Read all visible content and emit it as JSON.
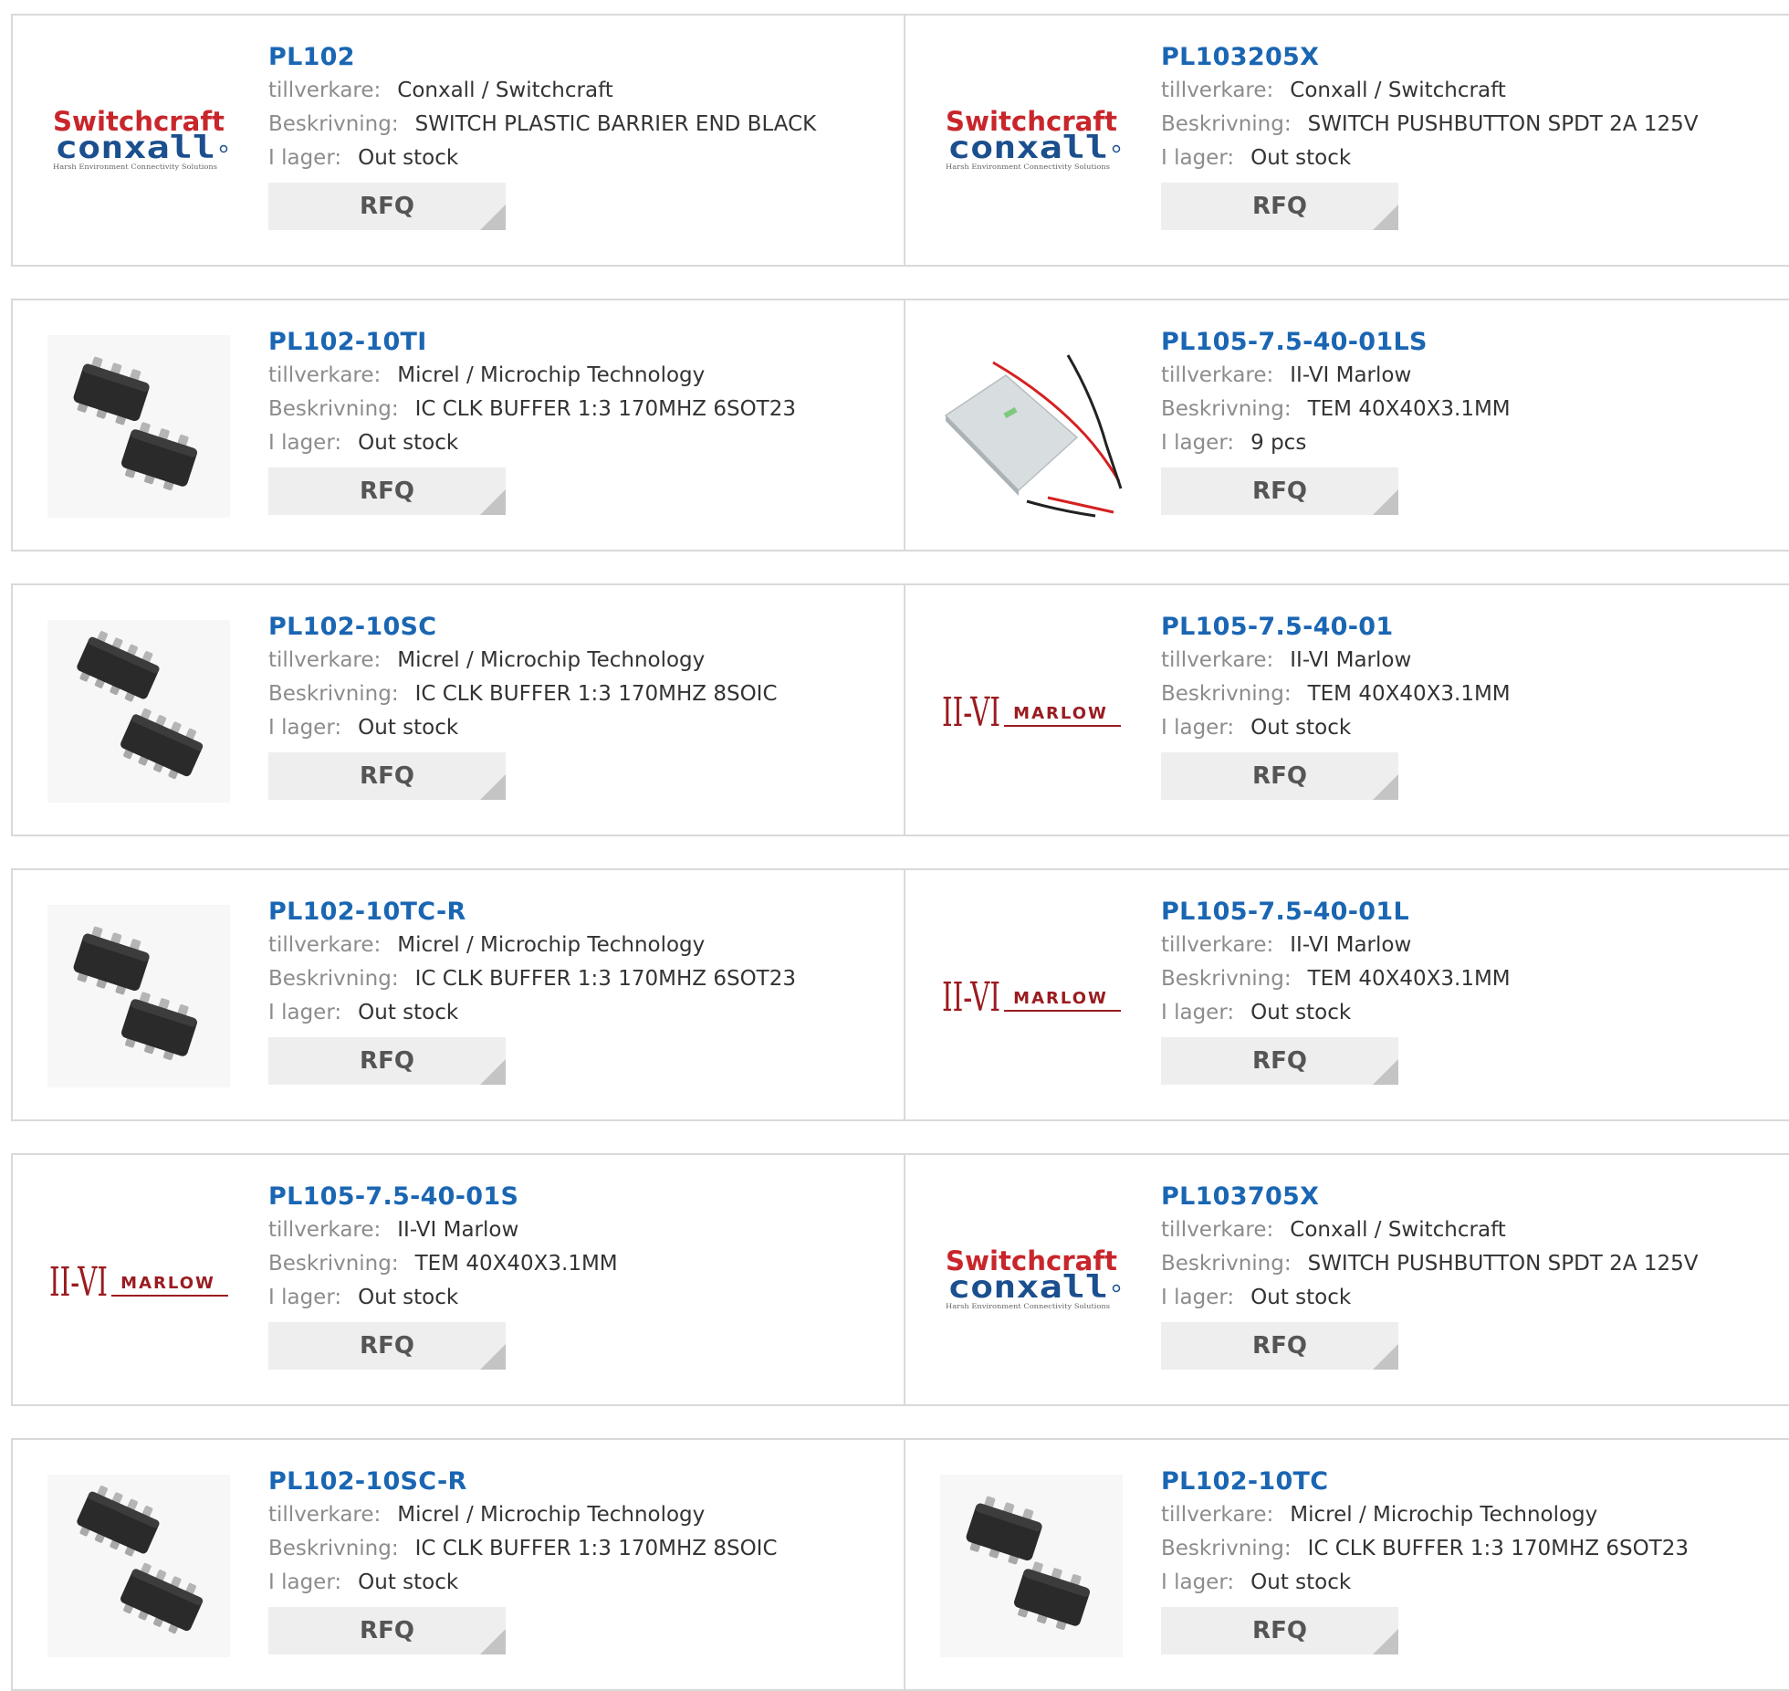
{
  "labels": {
    "manufacturer": "tillverkare:",
    "description": "Beskrivning:",
    "stock": "I lager:",
    "rfq": "RFQ"
  },
  "colors": {
    "link": "#1a66b3",
    "label": "#8c8c8c",
    "value": "#333333",
    "button_bg": "#eeeeee",
    "switchcraft_red": "#c8262b",
    "conxall_blue": "#1b4f8e",
    "marlow_red": "#9a1c20"
  },
  "products": [
    {
      "part": "PL102",
      "manufacturer": "Conxall / Switchcraft",
      "description": "SWITCH PLASTIC BARRIER END BLACK",
      "stock": "Out stock",
      "image": "switchcraft-conxall-logo",
      "logo_text": {
        "top": "Switchcraft",
        "bottom": "conxall",
        "tagline": "Harsh Environment Connectivity Solutions"
      }
    },
    {
      "part": "PL103205X",
      "manufacturer": "Conxall / Switchcraft",
      "description": "SWITCH PUSHBUTTON SPDT 2A 125V",
      "stock": "Out stock",
      "image": "switchcraft-conxall-logo",
      "logo_text": {
        "top": "Switchcraft",
        "bottom": "conxall",
        "tagline": "Harsh Environment Connectivity Solutions"
      }
    },
    {
      "part": "PL102-10TI",
      "manufacturer": "Micrel / Microchip Technology",
      "description": "IC CLK BUFFER 1:3 170MHZ 6SOT23",
      "stock": "Out stock",
      "image": "sot23-chip"
    },
    {
      "part": "PL105-7.5-40-01LS",
      "manufacturer": "II-VI Marlow",
      "description": "TEM 40X40X3.1MM",
      "stock": "9 pcs",
      "image": "thermoelectric-module"
    },
    {
      "part": "PL102-10SC",
      "manufacturer": "Micrel / Microchip Technology",
      "description": "IC CLK BUFFER 1:3 170MHZ 8SOIC",
      "stock": "Out stock",
      "image": "soic8-chip"
    },
    {
      "part": "PL105-7.5-40-01",
      "manufacturer": "II-VI Marlow",
      "description": "TEM 40X40X3.1MM",
      "stock": "Out stock",
      "image": "ii-vi-marlow-logo",
      "logo_text": {
        "mark": "II-VI",
        "word": "MARLOW"
      }
    },
    {
      "part": "PL102-10TC-R",
      "manufacturer": "Micrel / Microchip Technology",
      "description": "IC CLK BUFFER 1:3 170MHZ 6SOT23",
      "stock": "Out stock",
      "image": "sot23-chip"
    },
    {
      "part": "PL105-7.5-40-01L",
      "manufacturer": "II-VI Marlow",
      "description": "TEM 40X40X3.1MM",
      "stock": "Out stock",
      "image": "ii-vi-marlow-logo",
      "logo_text": {
        "mark": "II-VI",
        "word": "MARLOW"
      }
    },
    {
      "part": "PL105-7.5-40-01S",
      "manufacturer": "II-VI Marlow",
      "description": "TEM 40X40X3.1MM",
      "stock": "Out stock",
      "image": "ii-vi-marlow-logo",
      "logo_text": {
        "mark": "II-VI",
        "word": "MARLOW"
      }
    },
    {
      "part": "PL103705X",
      "manufacturer": "Conxall / Switchcraft",
      "description": "SWITCH PUSHBUTTON SPDT 2A 125V",
      "stock": "Out stock",
      "image": "switchcraft-conxall-logo",
      "logo_text": {
        "top": "Switchcraft",
        "bottom": "conxall",
        "tagline": "Harsh Environment Connectivity Solutions"
      }
    },
    {
      "part": "PL102-10SC-R",
      "manufacturer": "Micrel / Microchip Technology",
      "description": "IC CLK BUFFER 1:3 170MHZ 8SOIC",
      "stock": "Out stock",
      "image": "soic8-chip"
    },
    {
      "part": "PL102-10TC",
      "manufacturer": "Micrel / Microchip Technology",
      "description": "IC CLK BUFFER 1:3 170MHZ 6SOT23",
      "stock": "Out stock",
      "image": "sot23-chip"
    }
  ]
}
